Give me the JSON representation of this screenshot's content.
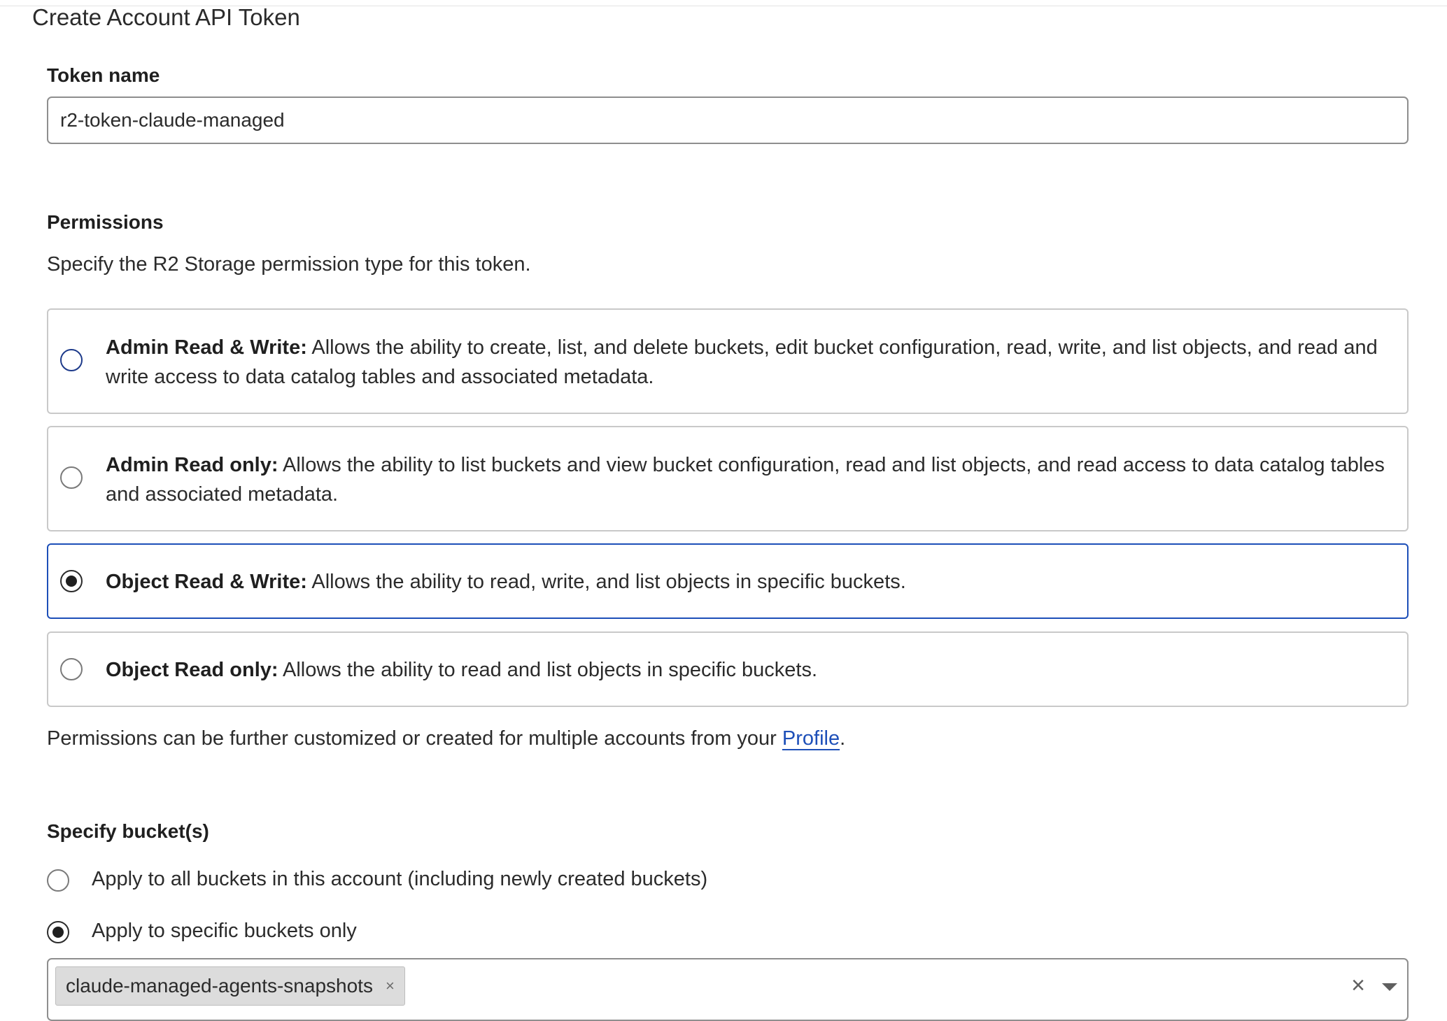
{
  "page": {
    "title": "Create Account API Token"
  },
  "token_name": {
    "label": "Token name",
    "value": "r2-token-claude-managed"
  },
  "permissions": {
    "label": "Permissions",
    "description": "Specify the R2 Storage permission type for this token.",
    "options": [
      {
        "title": "Admin Read & Write:",
        "description": " Allows the ability to create, list, and delete buckets, edit bucket configuration, read, write, and list objects, and read and write access to data catalog tables and associated metadata.",
        "selected": false
      },
      {
        "title": "Admin Read only:",
        "description": " Allows the ability to list buckets and view bucket configuration, read and list objects, and read access to data catalog tables and associated metadata.",
        "selected": false
      },
      {
        "title": "Object Read & Write:",
        "description": " Allows the ability to read, write, and list objects in specific buckets.",
        "selected": true
      },
      {
        "title": "Object Read only:",
        "description": " Allows the ability to read and list objects in specific buckets.",
        "selected": false
      }
    ],
    "footer_prefix": "Permissions can be further customized or created for multiple accounts from your ",
    "footer_link": "Profile",
    "footer_suffix": "."
  },
  "buckets": {
    "label": "Specify bucket(s)",
    "options": [
      {
        "label": "Apply to all buckets in this account (including newly created buckets)",
        "selected": false
      },
      {
        "label": "Apply to specific buckets only",
        "selected": true
      }
    ],
    "selected_chips": [
      "claude-managed-agents-snapshots"
    ],
    "chip_remove_glyph": "×",
    "clear_glyph": "×"
  },
  "colors": {
    "accent": "#1d4fb8",
    "border": "#c9c9c9",
    "text": "#2b2b2b"
  }
}
